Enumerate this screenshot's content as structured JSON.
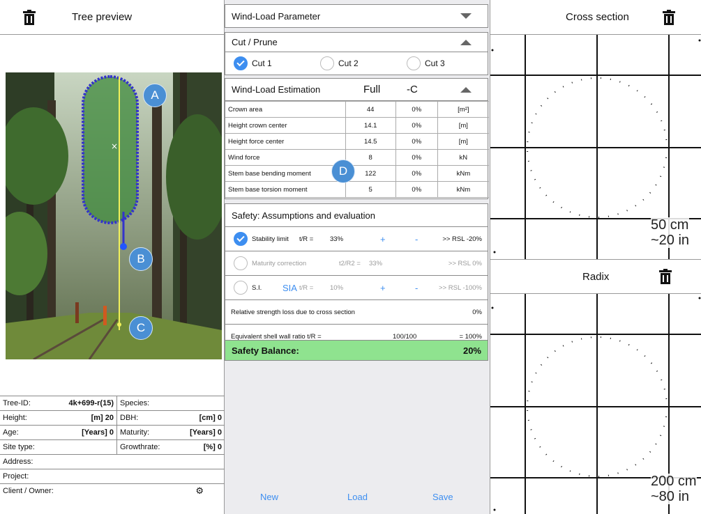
{
  "left": {
    "title": "Tree preview",
    "markers": [
      "A",
      "B",
      "C"
    ],
    "info": {
      "tree_id_label": "Tree-ID:",
      "tree_id_value": "4k+699-r(15)",
      "species_label": "Species:",
      "height_label": "Height:",
      "height_value": "[m] 20",
      "dbh_label": "DBH:",
      "dbh_value": "[cm] 0",
      "age_label": "Age:",
      "age_value": "[Years] 0",
      "maturity_label": "Maturity:",
      "maturity_value": "[Years] 0",
      "site_label": "Site type:",
      "growth_label": "Growthrate:",
      "growth_value": "[%] 0",
      "address_label": "Address:",
      "project_label": "Project:",
      "client_label": "Client / Owner:"
    }
  },
  "mid": {
    "windload_param": "Wind-Load Parameter",
    "cut_title": "Cut / Prune",
    "cuts": [
      "Cut 1",
      "Cut 2",
      "Cut 3"
    ],
    "wle_title": "Wind-Load Estimation",
    "wle_full": "Full",
    "wle_c": "-C",
    "marker_d": "D",
    "rows": [
      {
        "label": "Crown area",
        "value": "44",
        "pct": "0%",
        "unit": "[m²]"
      },
      {
        "label": "Height crown center",
        "value": "14.1",
        "pct": "0%",
        "unit": "[m]"
      },
      {
        "label": "Height force center",
        "value": "14.5",
        "pct": "0%",
        "unit": "[m]"
      },
      {
        "label": "Wind force",
        "value": "8",
        "pct": "0%",
        "unit": "kN"
      },
      {
        "label": "Stem base bending moment",
        "value": "122",
        "pct": "0%",
        "unit": "kNm"
      },
      {
        "label": "Stem base torsion moment",
        "value": "5",
        "pct": "0%",
        "unit": "kNm"
      }
    ],
    "safety_title": "Safety: Assumptions and evaluation",
    "stability": {
      "label": "Stability limit",
      "tr": "t/R =",
      "pct": "33%",
      "plus": "+",
      "minus": "-",
      "rsl": ">> RSL -20%"
    },
    "maturity": {
      "label": "Maturity correction",
      "tr": "t2/R2 =",
      "pct": "33%",
      "rsl": ">> RSL 0%"
    },
    "si": {
      "label": "S.I.",
      "sia": "SIA",
      "tr": "t/R =",
      "pct": "10%",
      "plus": "+",
      "minus": "-",
      "rsl": ">> RSL -100%"
    },
    "rel_loss": {
      "label": "Relative strength loss due to cross section",
      "value": "0%"
    },
    "shell": {
      "label": "Equivalent shell wall ratio t/R =",
      "ratio": "100/100",
      "value": "= 100%"
    },
    "balance": {
      "label": "Safety Balance:",
      "value": "20%"
    },
    "buttons": {
      "new": "New",
      "load": "Load",
      "save": "Save"
    }
  },
  "right": {
    "cross_title": "Cross section",
    "cross_scale": [
      "50 cm",
      "~20 in"
    ],
    "radix_title": "Radix",
    "radix_scale": [
      "200 cm",
      "~80 in"
    ]
  },
  "colors": {
    "accent": "#3d8ef0",
    "balance_bg": "#8fe38f",
    "marker": "#4a8fd4"
  }
}
